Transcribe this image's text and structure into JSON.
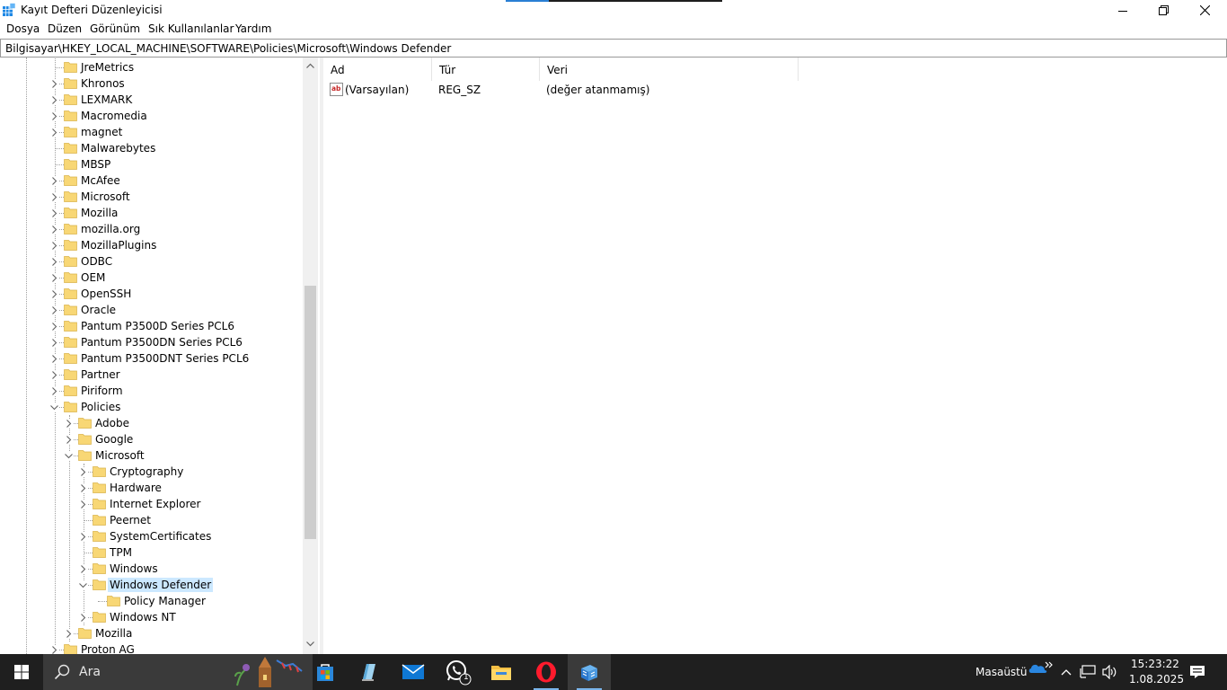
{
  "window": {
    "title": "Kayıt Defteri Düzenleyicisi"
  },
  "menu": [
    "Dosya",
    "Düzen",
    "Görünüm",
    "Sık Kullanılanlar",
    "Yardım"
  ],
  "address": "Bilgisayar\\HKEY_LOCAL_MACHINE\\SOFTWARE\\Policies\\Microsoft\\Windows Defender",
  "tree": [
    {
      "label": "JreMetrics",
      "depth": 0,
      "expander": "none"
    },
    {
      "label": "Khronos",
      "depth": 0,
      "expander": "collapsed"
    },
    {
      "label": "LEXMARK",
      "depth": 0,
      "expander": "collapsed"
    },
    {
      "label": "Macromedia",
      "depth": 0,
      "expander": "collapsed"
    },
    {
      "label": "magnet",
      "depth": 0,
      "expander": "collapsed"
    },
    {
      "label": "Malwarebytes",
      "depth": 0,
      "expander": "none"
    },
    {
      "label": "MBSP",
      "depth": 0,
      "expander": "none"
    },
    {
      "label": "McAfee",
      "depth": 0,
      "expander": "collapsed"
    },
    {
      "label": "Microsoft",
      "depth": 0,
      "expander": "collapsed"
    },
    {
      "label": "Mozilla",
      "depth": 0,
      "expander": "collapsed"
    },
    {
      "label": "mozilla.org",
      "depth": 0,
      "expander": "collapsed"
    },
    {
      "label": "MozillaPlugins",
      "depth": 0,
      "expander": "collapsed"
    },
    {
      "label": "ODBC",
      "depth": 0,
      "expander": "collapsed"
    },
    {
      "label": "OEM",
      "depth": 0,
      "expander": "collapsed"
    },
    {
      "label": "OpenSSH",
      "depth": 0,
      "expander": "collapsed"
    },
    {
      "label": "Oracle",
      "depth": 0,
      "expander": "collapsed"
    },
    {
      "label": "Pantum P3500D Series PCL6",
      "depth": 0,
      "expander": "collapsed"
    },
    {
      "label": "Pantum P3500DN Series PCL6",
      "depth": 0,
      "expander": "collapsed"
    },
    {
      "label": "Pantum P3500DNT Series PCL6",
      "depth": 0,
      "expander": "collapsed"
    },
    {
      "label": "Partner",
      "depth": 0,
      "expander": "collapsed"
    },
    {
      "label": "Piriform",
      "depth": 0,
      "expander": "collapsed"
    },
    {
      "label": "Policies",
      "depth": 0,
      "expander": "expanded"
    },
    {
      "label": "Adobe",
      "depth": 1,
      "expander": "collapsed"
    },
    {
      "label": "Google",
      "depth": 1,
      "expander": "collapsed"
    },
    {
      "label": "Microsoft",
      "depth": 1,
      "expander": "expanded"
    },
    {
      "label": "Cryptography",
      "depth": 2,
      "expander": "collapsed"
    },
    {
      "label": "Hardware",
      "depth": 2,
      "expander": "collapsed"
    },
    {
      "label": "Internet Explorer",
      "depth": 2,
      "expander": "collapsed"
    },
    {
      "label": "Peernet",
      "depth": 2,
      "expander": "none"
    },
    {
      "label": "SystemCertificates",
      "depth": 2,
      "expander": "collapsed"
    },
    {
      "label": "TPM",
      "depth": 2,
      "expander": "none"
    },
    {
      "label": "Windows",
      "depth": 2,
      "expander": "collapsed"
    },
    {
      "label": "Windows Defender",
      "depth": 2,
      "expander": "expanded",
      "selected": true
    },
    {
      "label": "Policy Manager",
      "depth": 3,
      "expander": "none"
    },
    {
      "label": "Windows NT",
      "depth": 2,
      "expander": "collapsed"
    },
    {
      "label": "Mozilla",
      "depth": 1,
      "expander": "collapsed"
    },
    {
      "label": "Proton AG",
      "depth": 0,
      "expander": "collapsed"
    }
  ],
  "columns": {
    "name": "Ad",
    "type": "Tür",
    "data": "Veri"
  },
  "values": [
    {
      "name": "(Varsayılan)",
      "type": "REG_SZ",
      "data": "(değer atanmamış)"
    }
  ],
  "taskbar": {
    "search_text": "Ara",
    "apps": [
      {
        "icon": "microsoft-store-icon"
      },
      {
        "icon": "notepad-icon"
      },
      {
        "icon": "mail-icon"
      },
      {
        "icon": "whatsapp-icon",
        "badge": "1"
      },
      {
        "icon": "file-explorer-icon"
      },
      {
        "icon": "opera-icon"
      },
      {
        "icon": "registry-editor-icon",
        "active": true
      }
    ],
    "desktop_label": "Masaüstü",
    "time": "15:23:22",
    "date": "1.08.2025"
  },
  "colors": {
    "folder": "#f8d775",
    "selection": "#cce8ff",
    "taskbar": "#1f1f1f",
    "accent": "#2a7fd4"
  }
}
